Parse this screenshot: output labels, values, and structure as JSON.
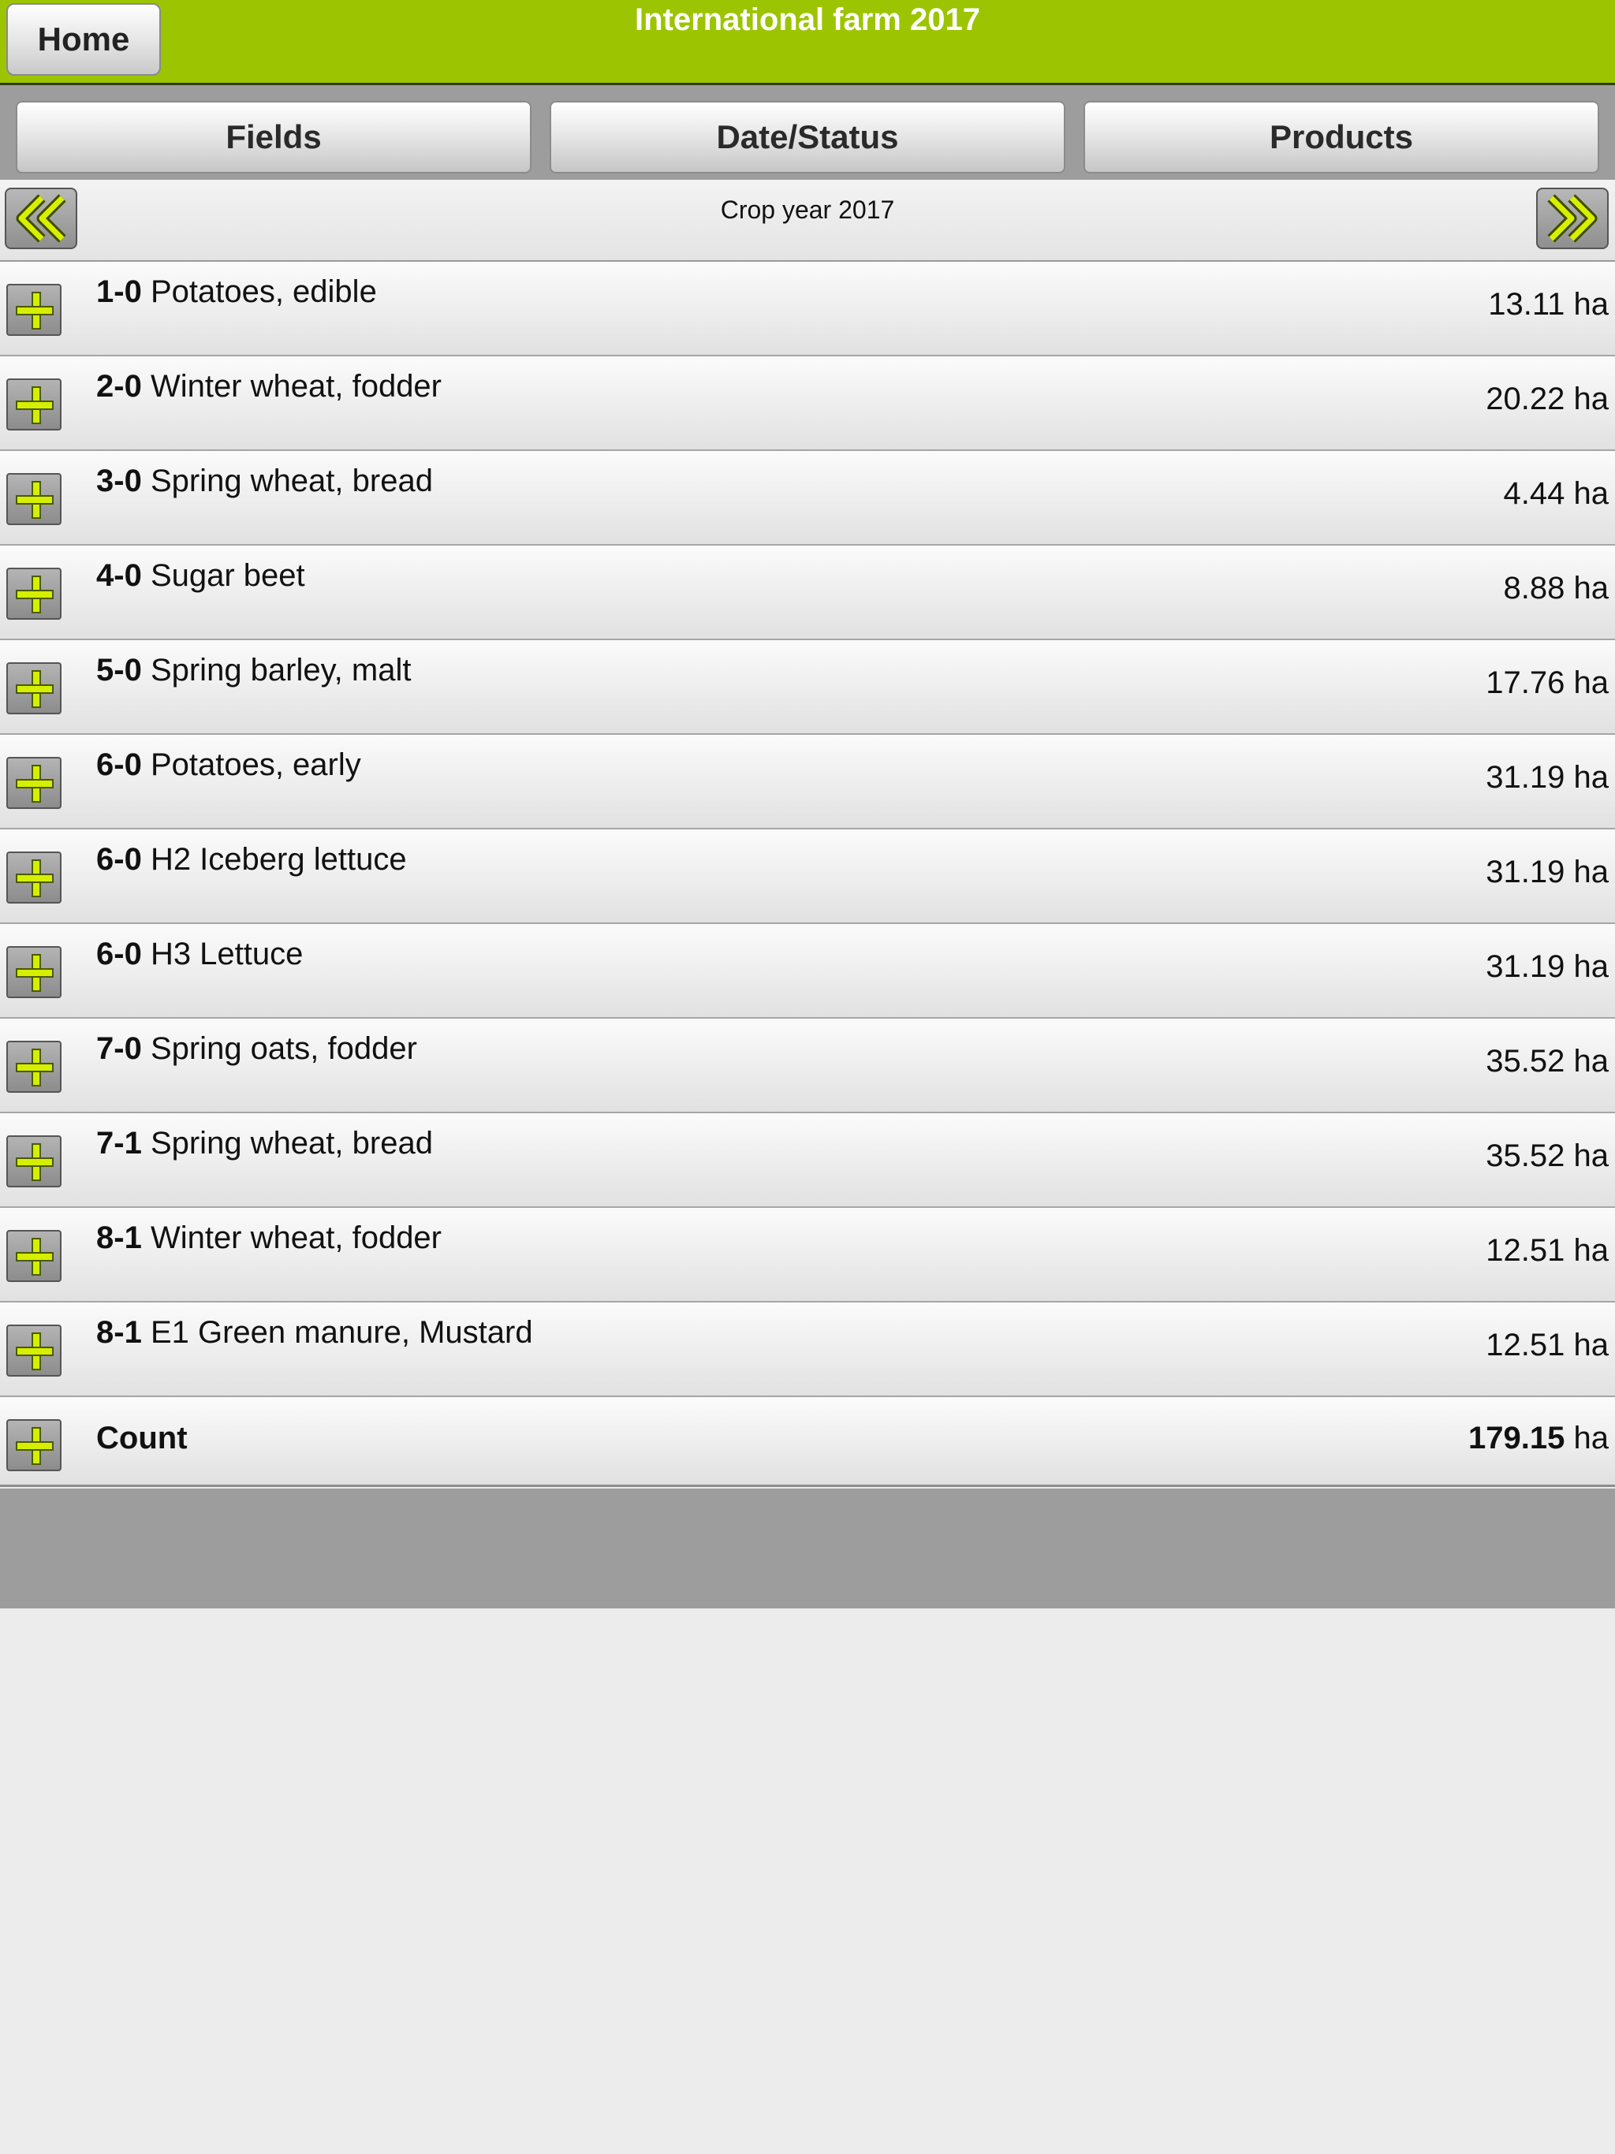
{
  "header": {
    "home_label": "Home",
    "title": "International farm 2017"
  },
  "tabs": [
    {
      "label": "Fields"
    },
    {
      "label": "Date/Status"
    },
    {
      "label": "Products"
    }
  ],
  "year_nav": {
    "label": "Crop year 2017",
    "prev_icon": "double-chevron-left-icon",
    "next_icon": "double-chevron-right-icon"
  },
  "colors": {
    "accent": "#9cc400",
    "plus": "#d6ef00",
    "band": "#9d9d9d"
  },
  "rows": [
    {
      "code": "1-0",
      "crop": "Potatoes, edible",
      "area": "13.11",
      "unit": "ha"
    },
    {
      "code": "2-0",
      "crop": "Winter wheat, fodder",
      "area": "20.22",
      "unit": "ha"
    },
    {
      "code": "3-0",
      "crop": "Spring wheat, bread",
      "area": "4.44",
      "unit": "ha"
    },
    {
      "code": "4-0",
      "crop": "Sugar beet",
      "area": "8.88",
      "unit": "ha"
    },
    {
      "code": "5-0",
      "crop": "Spring barley, malt",
      "area": "17.76",
      "unit": "ha"
    },
    {
      "code": "6-0",
      "crop": "Potatoes, early",
      "area": "31.19",
      "unit": "ha"
    },
    {
      "code": "6-0",
      "crop": "H2 Iceberg lettuce",
      "area": "31.19",
      "unit": "ha"
    },
    {
      "code": "6-0",
      "crop": "H3 Lettuce",
      "area": "31.19",
      "unit": "ha"
    },
    {
      "code": "7-0",
      "crop": "Spring oats, fodder",
      "area": "35.52",
      "unit": "ha"
    },
    {
      "code": "7-1",
      "crop": "Spring wheat, bread",
      "area": "35.52",
      "unit": "ha"
    },
    {
      "code": "8-1",
      "crop": "Winter wheat, fodder",
      "area": "12.51",
      "unit": "ha"
    },
    {
      "code": "8-1",
      "crop": "E1 Green manure, Mustard",
      "area": "12.51",
      "unit": "ha"
    }
  ],
  "total": {
    "label": "Count",
    "area": "179.15",
    "unit": "ha"
  }
}
